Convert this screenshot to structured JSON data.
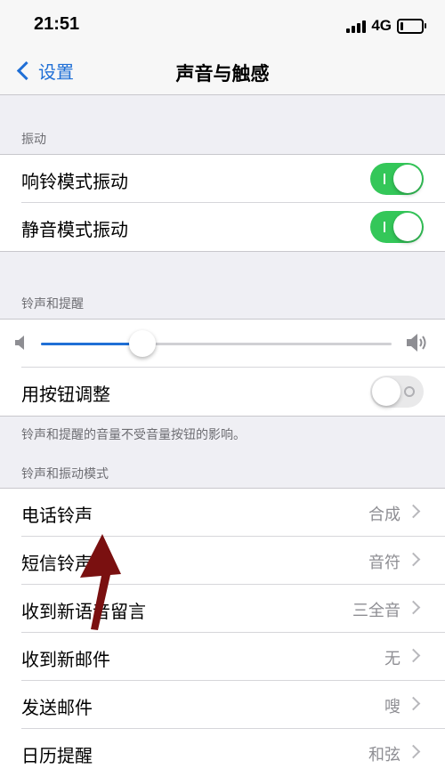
{
  "status": {
    "time": "21:51",
    "network": "4G",
    "battery_level": 0.15
  },
  "nav": {
    "back_label": "设置",
    "title": "声音与触感"
  },
  "vibration": {
    "header": "振动",
    "rows": [
      {
        "label": "响铃模式振动",
        "on": true
      },
      {
        "label": "静音模式振动",
        "on": true
      }
    ]
  },
  "ringer": {
    "header": "铃声和提醒",
    "volume_level": 0.29,
    "change_with_buttons": {
      "label": "用按钮调整",
      "on": false
    },
    "note": "铃声和提醒的音量不受音量按钮的影响。"
  },
  "patterns": {
    "header": "铃声和振动模式",
    "rows": [
      {
        "label": "电话铃声",
        "value": "合成"
      },
      {
        "label": "短信铃声",
        "value": "音符"
      },
      {
        "label": "收到新语音留言",
        "value": "三全音"
      },
      {
        "label": "收到新邮件",
        "value": "无"
      },
      {
        "label": "发送邮件",
        "value": "嗖"
      },
      {
        "label": "日历提醒",
        "value": "和弦"
      }
    ]
  },
  "colors": {
    "accent": "#1f6fd6",
    "toggle_on": "#34c759",
    "annotation_arrow": "#7a1010"
  },
  "icons": [
    "back-chevron-icon",
    "volume-low-icon",
    "volume-high-icon",
    "chevron-right-icon",
    "annotation-arrow-icon"
  ]
}
